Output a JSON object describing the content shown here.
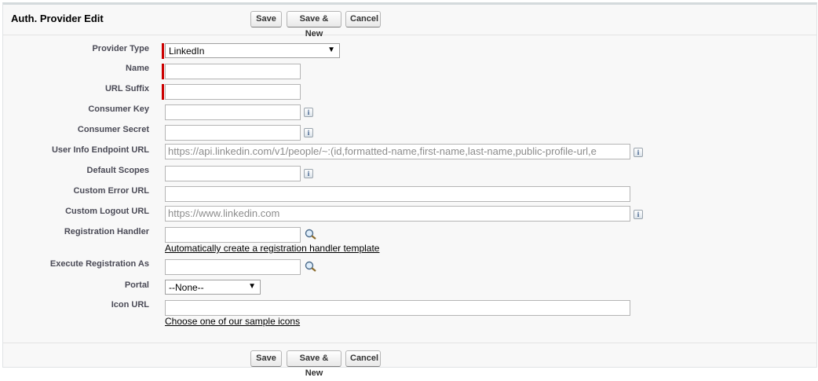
{
  "header": {
    "title": "Auth. Provider Edit",
    "save": "Save",
    "save_new": "Save & New",
    "cancel": "Cancel"
  },
  "form": {
    "provider_type": {
      "label": "Provider Type",
      "value": "LinkedIn",
      "arrow": "▼"
    },
    "name": {
      "label": "Name",
      "value": ""
    },
    "url_suffix": {
      "label": "URL Suffix",
      "value": ""
    },
    "consumer_key": {
      "label": "Consumer Key",
      "value": ""
    },
    "consumer_secret": {
      "label": "Consumer Secret",
      "value": ""
    },
    "user_info_endpoint_url": {
      "label": "User Info Endpoint URL",
      "placeholder": "https://api.linkedin.com/v1/people/~:(id,formatted-name,first-name,last-name,public-profile-url,e"
    },
    "default_scopes": {
      "label": "Default Scopes",
      "value": ""
    },
    "custom_error_url": {
      "label": "Custom Error URL",
      "value": ""
    },
    "custom_logout_url": {
      "label": "Custom Logout URL",
      "placeholder": "https://www.linkedin.com"
    },
    "registration_handler": {
      "label": "Registration Handler",
      "value": "",
      "link": "Automatically create a registration handler template"
    },
    "execute_registration_as": {
      "label": "Execute Registration As",
      "value": ""
    },
    "portal": {
      "label": "Portal",
      "value": "--None--",
      "arrow": "▼"
    },
    "icon_url": {
      "label": "Icon URL",
      "value": "",
      "link": "Choose one of our sample icons"
    },
    "info_glyph": "i"
  },
  "footer": {
    "save": "Save",
    "save_new": "Save & New",
    "cancel": "Cancel"
  }
}
